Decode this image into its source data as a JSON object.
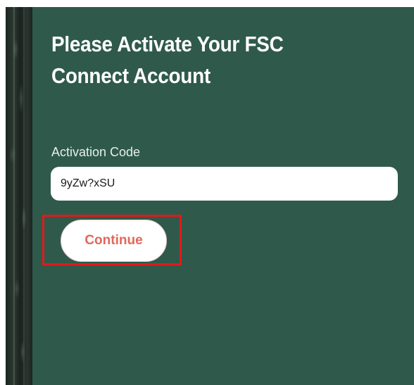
{
  "page": {
    "title": "Please Activate Your FSC Connect Account"
  },
  "activation": {
    "label": "Activation Code",
    "value": "9yZw?xSU"
  },
  "actions": {
    "continue_label": "Continue"
  },
  "colors": {
    "panel_background": "#2f5a4b",
    "button_text": "#e2675b",
    "highlight_border": "#e0191b"
  }
}
